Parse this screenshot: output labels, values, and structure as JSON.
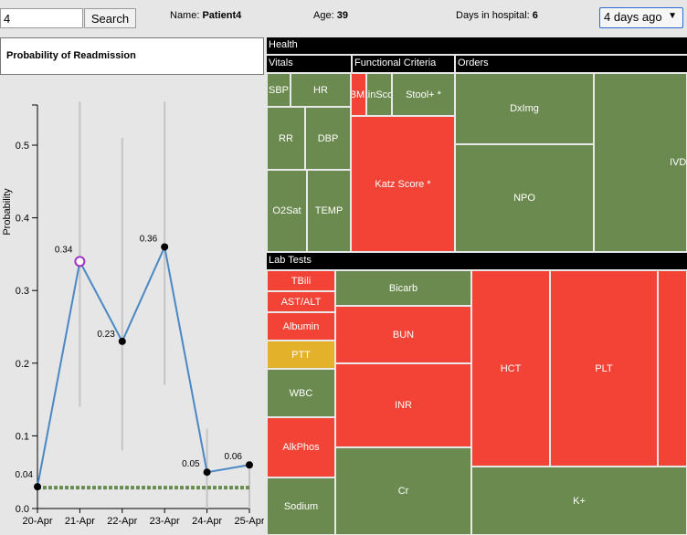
{
  "search": {
    "value": "4",
    "button_label": "Search"
  },
  "patient": {
    "name_label": "Name:",
    "name": "Patient4",
    "age_label": "Age:",
    "age": "39",
    "days_label": "Days in hospital:",
    "days": "6"
  },
  "time_range": {
    "selected": "4 days ago",
    "caret": "▼"
  },
  "colors": {
    "good": "#6b8a4f",
    "bad": "#f34336",
    "warning": "#e4b12a",
    "line": "#4a88c4",
    "highlight": "#a12fc4",
    "baseline": "#6b8a4f"
  },
  "chart_data": {
    "type": "line",
    "title": "Probability of Readmission",
    "xlabel": "",
    "ylabel": "Probability",
    "ylim": [
      0,
      0.56
    ],
    "yticks": [
      "0.0",
      "0.1",
      "0.2",
      "0.3",
      "0.4",
      "0.5"
    ],
    "categories": [
      "20-Apr",
      "21-Apr",
      "22-Apr",
      "23-Apr",
      "24-Apr",
      "25-Apr"
    ],
    "values": [
      0.03,
      0.34,
      0.23,
      0.36,
      0.05,
      0.06
    ],
    "point_labels": [
      "0.04",
      "0.34",
      "0.23",
      "0.36",
      "0.05",
      "0.06"
    ],
    "highlighted_point": 1,
    "baseline": 0.03,
    "error_bars": [
      {
        "low": 0.03,
        "high": 0.03
      },
      {
        "low": 0.14,
        "high": 0.56
      },
      {
        "low": 0.08,
        "high": 0.51
      },
      {
        "low": 0.17,
        "high": 0.56
      },
      {
        "low": 0.0,
        "high": 0.11
      },
      {
        "low": 0.0,
        "high": 0.06
      }
    ]
  },
  "treemap": {
    "health_label": "Health",
    "vitals_label": "Vitals",
    "functional_label": "Functional Criteria",
    "orders_label": "Orders",
    "lab_tests_label": "Lab Tests",
    "vitals": {
      "sbp": "SBP",
      "hr": "HR",
      "rr": "RR",
      "dbp": "DBP",
      "o2sat": "O2Sat",
      "temp": "TEMP"
    },
    "functional": {
      "bmi": "BMI",
      "skin": "SkinScore",
      "stool": "Stool+ *",
      "katz": "Katz Score *"
    },
    "orders": {
      "dximg": "DxImg",
      "npo": "NPO",
      "ivd": "IVD"
    },
    "labs": {
      "tbili": "TBili",
      "astalt": "AST/ALT",
      "albumin": "Albumin",
      "ptt": "PTT",
      "wbc": "WBC",
      "alkphos": "AlkPhos",
      "sodium": "Sodium",
      "bicarb": "Bicarb",
      "bun": "BUN",
      "inr": "INR",
      "cr": "Cr",
      "hct": "HCT",
      "plt": "PLT",
      "k": "K+"
    }
  }
}
